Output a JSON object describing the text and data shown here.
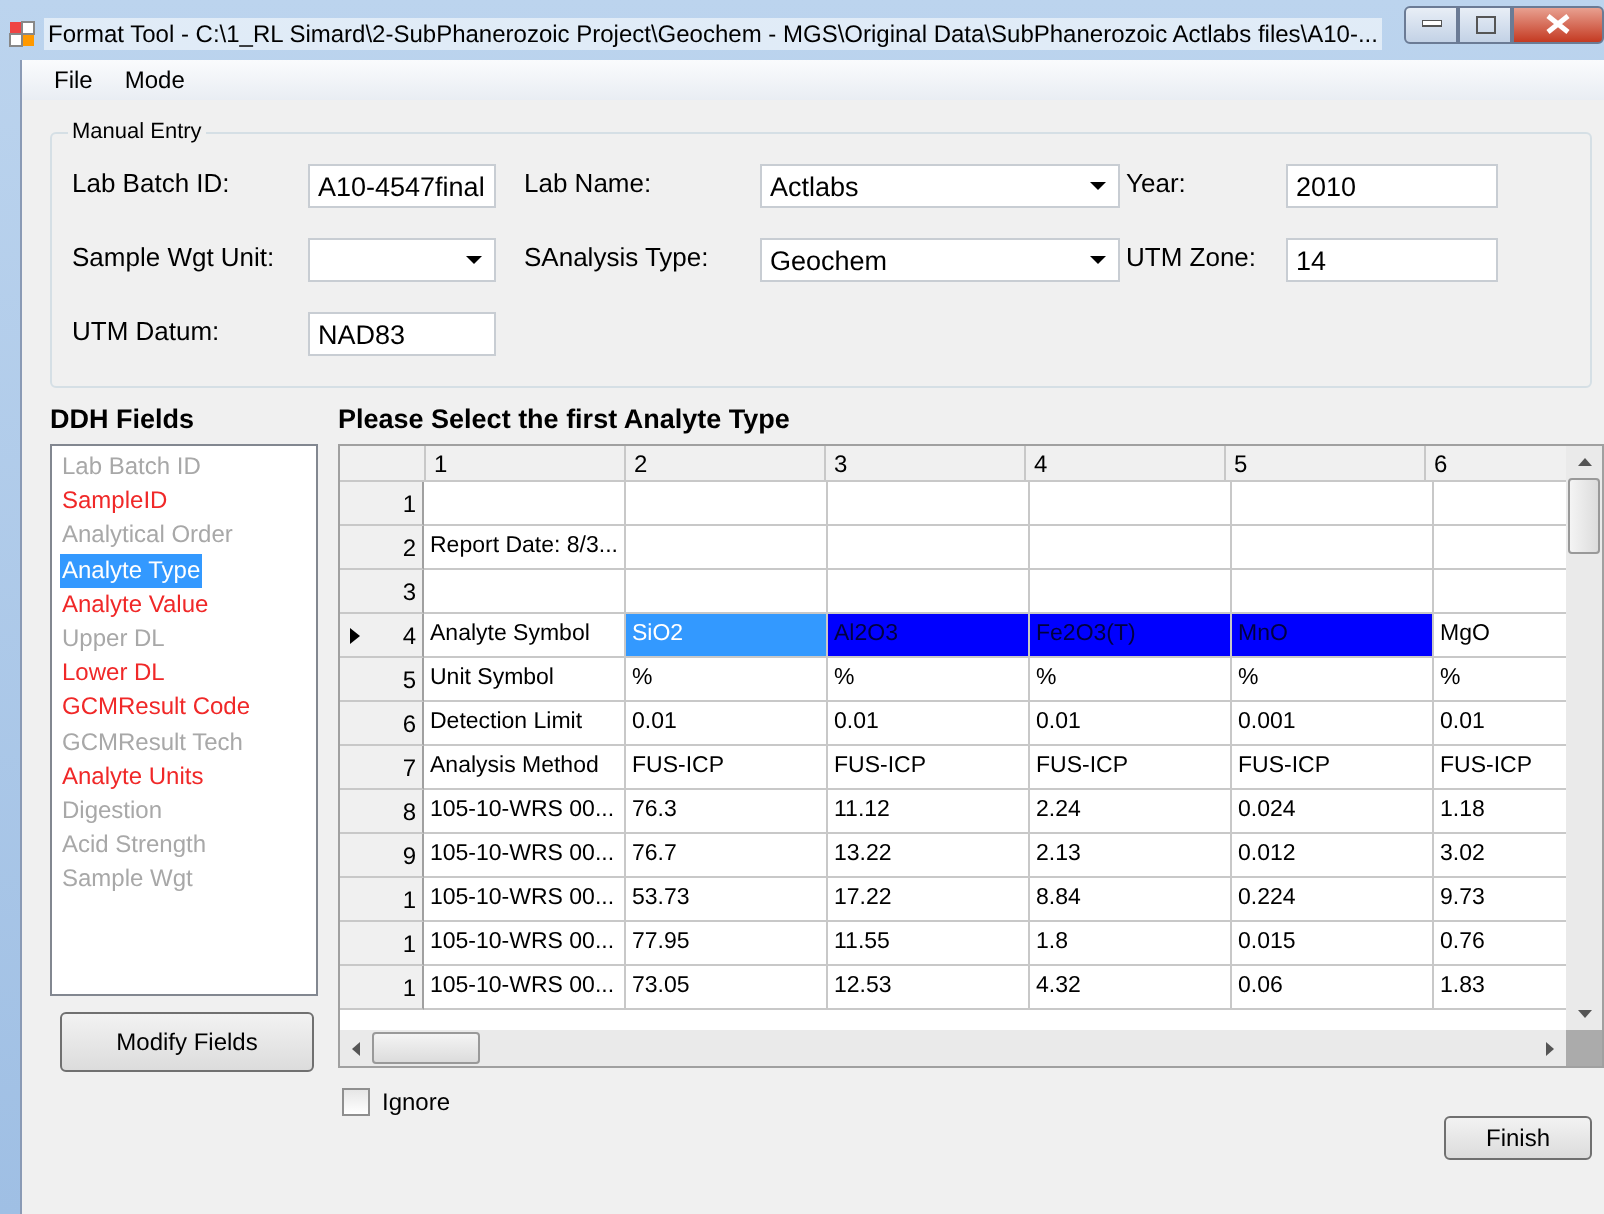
{
  "window": {
    "title": "Format Tool  - C:\\1_RL Simard\\2-SubPhanerozoic Project\\Geochem - MGS\\Original Data\\SubPhanerozoic Actlabs files\\A10-..."
  },
  "menu": [
    "File",
    "Mode"
  ],
  "manual_entry": {
    "title": "Manual Entry",
    "fields": [
      {
        "label": "Lab Batch ID:",
        "kind": "text",
        "value": "A10-4547final"
      },
      {
        "label": "Lab Name:",
        "kind": "combo",
        "value": "Actlabs"
      },
      {
        "label": "Year:",
        "kind": "text",
        "value": "2010"
      },
      {
        "label": "Sample Wgt Unit:",
        "kind": "combo"
      },
      {
        "label": "SAnalysis Type:",
        "kind": "combo",
        "value": "Geochem"
      },
      {
        "label": "UTM Zone:",
        "kind": "text",
        "value": "14"
      },
      {
        "label": "UTM Datum:",
        "kind": "text",
        "value": "NAD83"
      }
    ]
  },
  "ddh_fields": {
    "title": "DDH Fields",
    "items": [
      {
        "label": "Lab Batch ID",
        "required": false,
        "selected": false
      },
      {
        "label": "SampleID",
        "required": true,
        "selected": false
      },
      {
        "label": "Analytical Order",
        "required": false,
        "selected": false
      },
      {
        "label": "Analyte Type",
        "required": false,
        "selected": true
      },
      {
        "label": "Analyte Value",
        "required": true,
        "selected": false
      },
      {
        "label": "Upper DL",
        "required": false,
        "selected": false
      },
      {
        "label": "Lower DL",
        "required": true,
        "selected": false
      },
      {
        "label": "GCMResult Code",
        "required": true,
        "selected": false
      },
      {
        "label": "GCMResult Tech",
        "required": false,
        "selected": false
      },
      {
        "label": "Analyte Units",
        "required": true,
        "selected": false
      },
      {
        "label": "Digestion",
        "required": false,
        "selected": false
      },
      {
        "label": "Acid Strength",
        "required": false,
        "selected": false
      },
      {
        "label": "Sample Wgt",
        "required": false,
        "selected": false
      }
    ],
    "button": "Modify Fields"
  },
  "grid": {
    "title": "Please Select the first Analyte Type",
    "columns": [
      "1",
      "2",
      "3",
      "4",
      "5",
      "6"
    ],
    "rows": [
      {
        "header": "1",
        "current": false,
        "cells": [
          "",
          "",
          "",
          "",
          "",
          ""
        ]
      },
      {
        "header": "2",
        "current": false,
        "cells": [
          "Report Date: 8/3...",
          "",
          "",
          "",
          "",
          ""
        ]
      },
      {
        "header": "3",
        "current": false,
        "cells": [
          "",
          "",
          "",
          "",
          "",
          ""
        ]
      },
      {
        "header": "4",
        "current": true,
        "cells": [
          "Analyte Symbol",
          {
            "text": "SiO2",
            "kind": "selected"
          },
          {
            "text": "Al2O3",
            "kind": "marked"
          },
          {
            "text": "Fe2O3(T)",
            "kind": "marked"
          },
          {
            "text": "MnO",
            "kind": "marked"
          },
          "MgO"
        ]
      },
      {
        "header": "5",
        "current": false,
        "cells": [
          "Unit Symbol",
          "%",
          "%",
          "%",
          "%",
          "%"
        ]
      },
      {
        "header": "6",
        "current": false,
        "cells": [
          "Detection Limit",
          "0.01",
          "0.01",
          "0.01",
          "0.001",
          "0.01"
        ]
      },
      {
        "header": "7",
        "current": false,
        "cells": [
          "Analysis Method",
          "FUS-ICP",
          "FUS-ICP",
          "FUS-ICP",
          "FUS-ICP",
          "FUS-ICP"
        ]
      },
      {
        "header": "8",
        "current": false,
        "cells": [
          "105-10-WRS 00...",
          "76.3",
          "11.12",
          "2.24",
          "0.024",
          "1.18"
        ]
      },
      {
        "header": "9",
        "current": false,
        "cells": [
          "105-10-WRS 00...",
          "76.7",
          "13.22",
          "2.13",
          "0.012",
          "3.02"
        ]
      },
      {
        "header": "1",
        "current": false,
        "cells": [
          "105-10-WRS 00...",
          "53.73",
          "17.22",
          "8.84",
          "0.224",
          "9.73"
        ]
      },
      {
        "header": "1",
        "current": false,
        "cells": [
          "105-10-WRS 00...",
          "77.95",
          "11.55",
          "1.8",
          "0.015",
          "0.76"
        ]
      },
      {
        "header": "1",
        "current": false,
        "cells": [
          "105-10-WRS 00...",
          "73.05",
          "12.53",
          "4.32",
          "0.06",
          "1.83"
        ]
      }
    ]
  },
  "ignore": {
    "label": "Ignore",
    "checked": false
  },
  "finish_button": "Finish"
}
